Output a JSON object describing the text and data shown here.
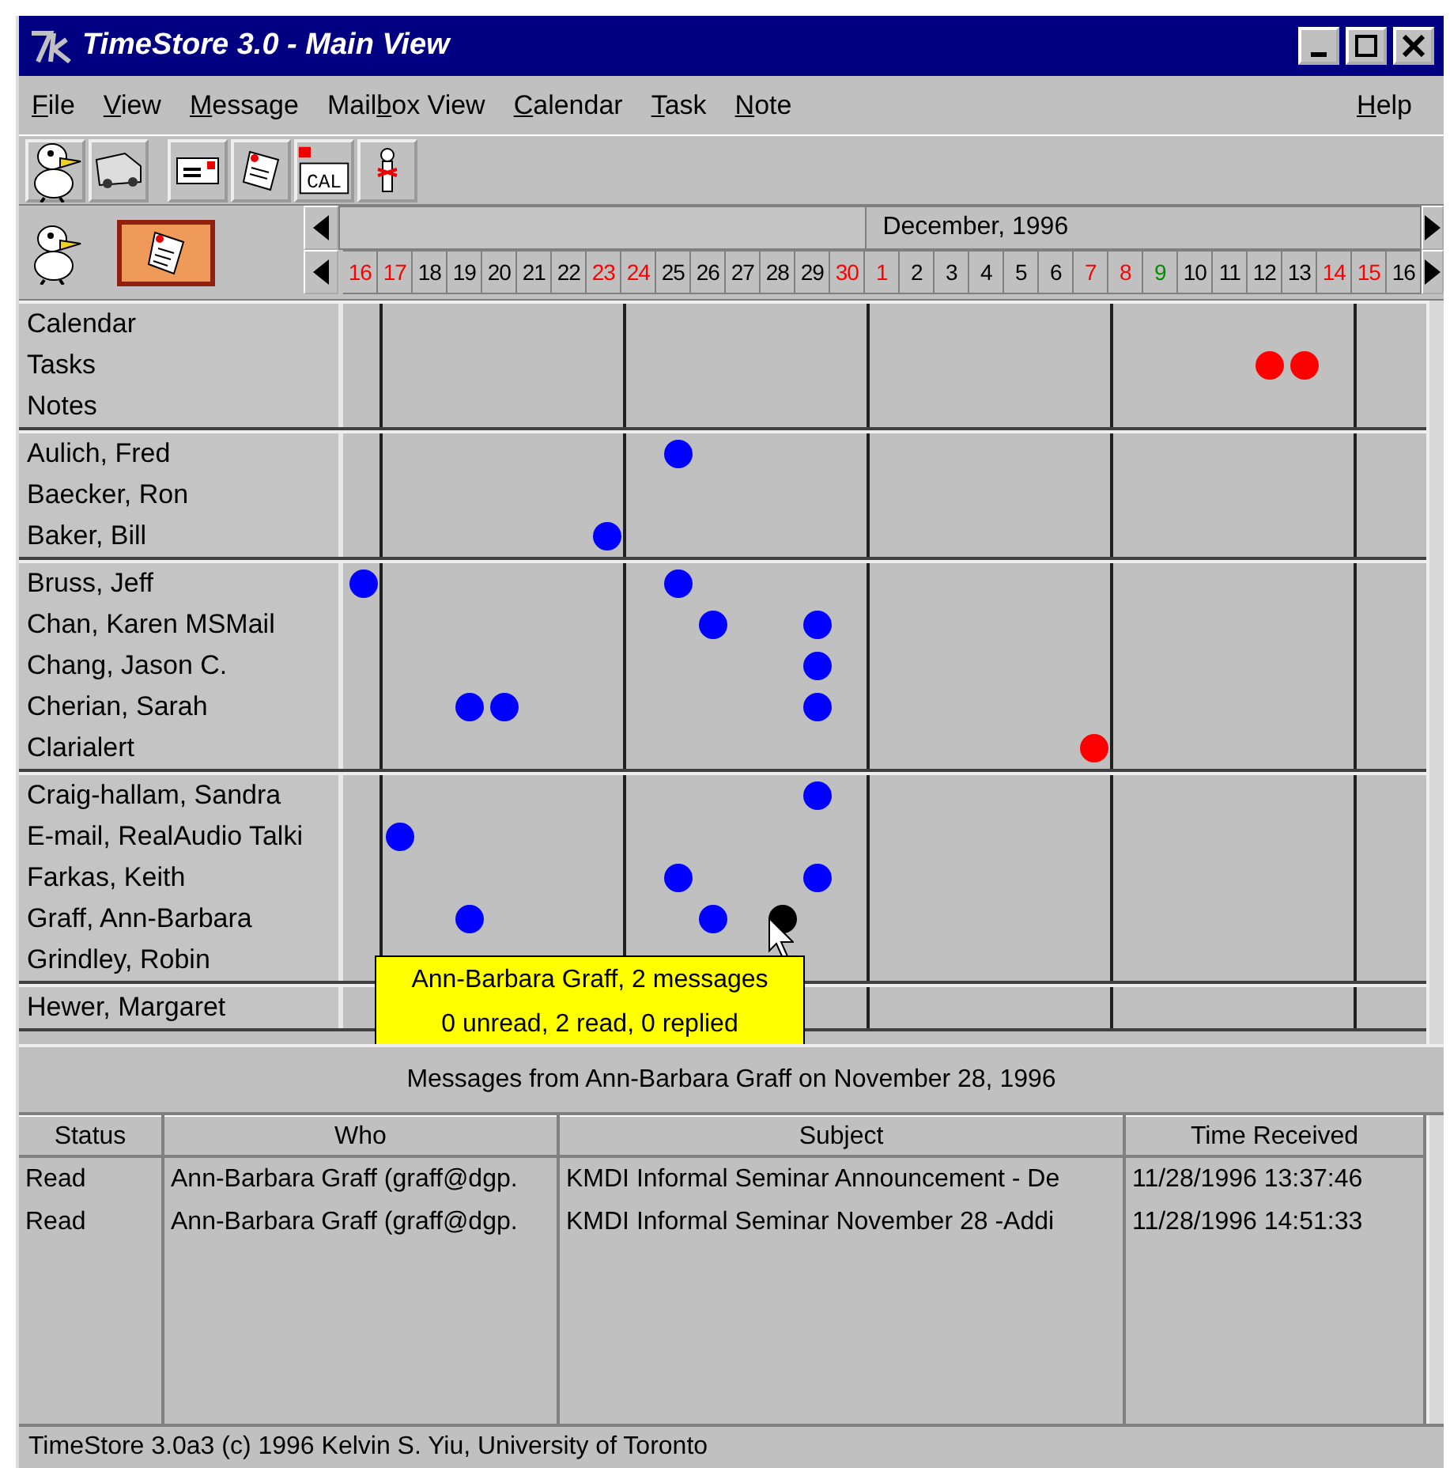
{
  "window": {
    "title": "TimeStore 3.0 - Main View"
  },
  "menu": [
    {
      "key": "F",
      "post": "ile"
    },
    {
      "key": "V",
      "post": "iew"
    },
    {
      "key": "M",
      "post": "essage"
    },
    {
      "pre": "Mail",
      "key": "b",
      "post": "ox View"
    },
    {
      "key": "C",
      "post": "alendar"
    },
    {
      "key": "T",
      "post": "ask"
    },
    {
      "key": "N",
      "post": "ote"
    }
  ],
  "help_menu": {
    "key": "H",
    "post": "elp"
  },
  "toolbar": {
    "calendar_label": "CAL"
  },
  "calendar_header": {
    "previous_days": [
      {
        "label": "16",
        "color": "#ff0000"
      },
      {
        "label": "17",
        "color": "#ff0000"
      },
      {
        "label": "18",
        "color": "#000000"
      },
      {
        "label": "19",
        "color": "#000000"
      },
      {
        "label": "20",
        "color": "#000000"
      },
      {
        "label": "21",
        "color": "#000000"
      },
      {
        "label": "22",
        "color": "#000000"
      },
      {
        "label": "23",
        "color": "#ff0000"
      },
      {
        "label": "24",
        "color": "#ff0000"
      },
      {
        "label": "25",
        "color": "#000000"
      },
      {
        "label": "26",
        "color": "#000000"
      },
      {
        "label": "27",
        "color": "#000000"
      },
      {
        "label": "28",
        "color": "#000000"
      },
      {
        "label": "29",
        "color": "#000000"
      },
      {
        "label": "30",
        "color": "#ff0000"
      }
    ],
    "month": {
      "label": "December, 1996",
      "days": [
        {
          "label": "1",
          "color": "#ff0000"
        },
        {
          "label": "2",
          "color": "#000000"
        },
        {
          "label": "3",
          "color": "#000000"
        },
        {
          "label": "4",
          "color": "#000000"
        },
        {
          "label": "5",
          "color": "#000000"
        },
        {
          "label": "6",
          "color": "#000000"
        },
        {
          "label": "7",
          "color": "#ff0000"
        },
        {
          "label": "8",
          "color": "#ff0000"
        },
        {
          "label": "9",
          "color": "#008f00"
        },
        {
          "label": "10",
          "color": "#000000"
        },
        {
          "label": "11",
          "color": "#000000"
        },
        {
          "label": "12",
          "color": "#000000"
        },
        {
          "label": "13",
          "color": "#000000"
        },
        {
          "label": "14",
          "color": "#ff0000"
        },
        {
          "label": "15",
          "color": "#ff0000"
        },
        {
          "label": "16",
          "color": "#000000"
        }
      ]
    }
  },
  "groups": [
    {
      "rows": [
        {
          "name": "Calendar"
        },
        {
          "name": "Tasks",
          "cells": [
            null,
            null,
            null,
            null,
            null,
            null,
            null,
            null,
            null,
            null,
            null,
            null,
            null,
            null,
            null,
            null,
            null,
            null,
            null,
            null,
            null,
            null,
            null,
            null,
            null,
            null,
            {
              "color": "#ff0000"
            },
            {
              "color": "#ff0000"
            }
          ]
        },
        {
          "name": "Notes"
        }
      ]
    },
    {
      "rows": [
        {
          "name": "Aulich, Fred",
          "cells": [
            null,
            null,
            null,
            null,
            null,
            null,
            null,
            null,
            null,
            {
              "color": "#0000ff"
            }
          ]
        },
        {
          "name": "Baecker, Ron"
        },
        {
          "name": "Baker, Bill",
          "cells": [
            null,
            null,
            null,
            null,
            null,
            null,
            null,
            {
              "color": "#0000ff"
            }
          ]
        }
      ]
    },
    {
      "rows": [
        {
          "name": "Bruss, Jeff",
          "cells": [
            {
              "color": "#0000ff"
            },
            null,
            null,
            null,
            null,
            null,
            null,
            null,
            null,
            {
              "color": "#0000ff"
            }
          ]
        },
        {
          "name": "Chan, Karen  MSMail",
          "cells": [
            null,
            null,
            null,
            null,
            null,
            null,
            null,
            null,
            null,
            null,
            {
              "color": "#0000ff"
            },
            null,
            null,
            {
              "color": "#0000ff"
            }
          ]
        },
        {
          "name": "Chang, Jason C.",
          "cells": [
            null,
            null,
            null,
            null,
            null,
            null,
            null,
            null,
            null,
            null,
            null,
            null,
            null,
            {
              "color": "#0000ff"
            }
          ]
        },
        {
          "name": "Cherian, Sarah",
          "cells": [
            null,
            null,
            null,
            {
              "color": "#0000ff"
            },
            {
              "color": "#0000ff"
            },
            null,
            null,
            null,
            null,
            null,
            null,
            null,
            null,
            {
              "color": "#0000ff"
            }
          ]
        },
        {
          "name": "Clarialert",
          "cells": [
            null,
            null,
            null,
            null,
            null,
            null,
            null,
            null,
            null,
            null,
            null,
            null,
            null,
            null,
            null,
            null,
            null,
            null,
            null,
            null,
            null,
            {
              "color": "#ff0000"
            }
          ]
        }
      ]
    },
    {
      "rows": [
        {
          "name": "Craig-hallam, Sandra",
          "cells": [
            null,
            null,
            null,
            null,
            null,
            null,
            null,
            null,
            null,
            null,
            null,
            null,
            null,
            {
              "color": "#0000ff"
            }
          ]
        },
        {
          "name": "E-mail, RealAudio Talki",
          "cells": [
            null,
            {
              "color": "#0000ff"
            }
          ]
        },
        {
          "name": "Farkas, Keith",
          "cells": [
            null,
            null,
            null,
            null,
            null,
            null,
            null,
            null,
            null,
            {
              "color": "#0000ff"
            },
            null,
            null,
            null,
            {
              "color": "#0000ff"
            }
          ]
        },
        {
          "name": "Graff, Ann-Barbara",
          "cells": [
            null,
            null,
            null,
            {
              "color": "#0000ff"
            },
            null,
            null,
            null,
            null,
            null,
            null,
            {
              "color": "#0000ff"
            },
            null,
            {
              "color": "#000000"
            }
          ]
        },
        {
          "name": "Grindley, Robin"
        }
      ]
    },
    {
      "rows": [
        {
          "name": "Hewer, Margaret"
        }
      ]
    }
  ],
  "tooltip": {
    "line_1": "Ann-Barbara Graff, 2 messages",
    "line_2": "0 unread, 2 read, 0 replied"
  },
  "messages_caption": "Messages from Ann-Barbara Graff on November 28, 1996",
  "table": {
    "columns": [
      "Status",
      "Who",
      "Subject",
      "Time Received"
    ],
    "rows": [
      [
        "Read",
        "Ann-Barbara Graff (graff@dgp.",
        "KMDI Informal Seminar Announcement - De",
        "11/28/1996 13:37:46"
      ],
      [
        "Read",
        "Ann-Barbara Graff (graff@dgp.",
        "KMDI Informal Seminar November 28 -Addi",
        "11/28/1996 14:51:33"
      ]
    ]
  },
  "status_bar": "TimeStore 3.0a3 (c) 1996 Kelvin S. Yiu, University of Toronto"
}
